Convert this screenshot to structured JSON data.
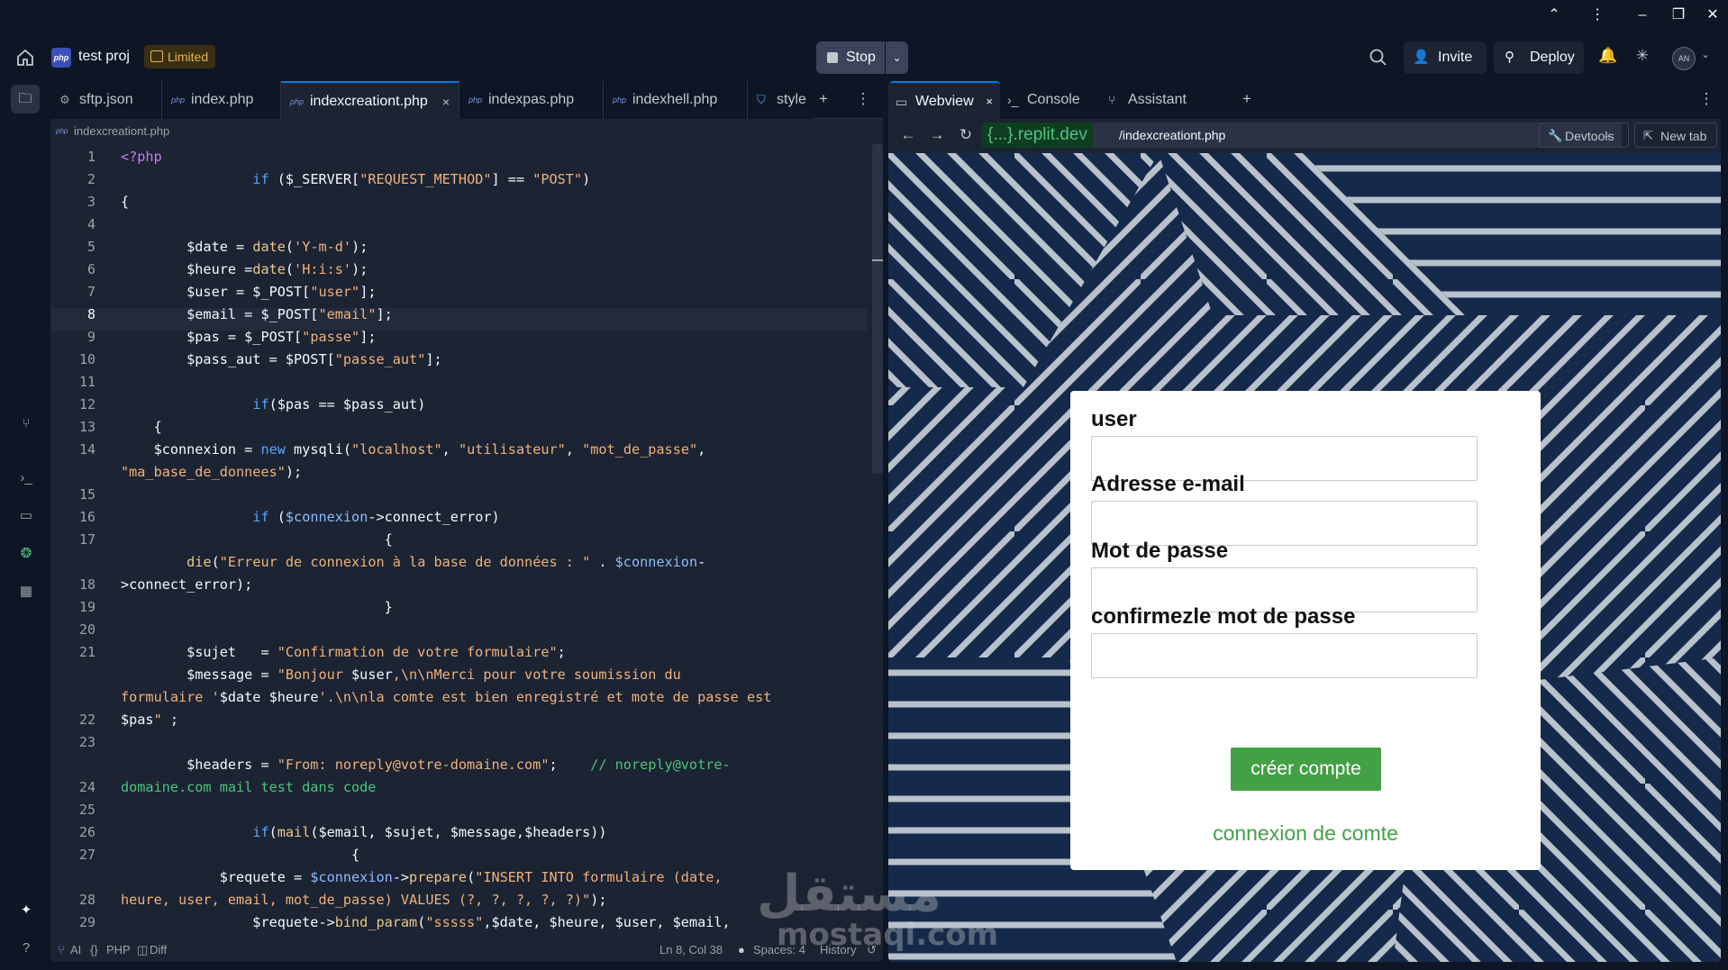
{
  "window": {
    "controls": [
      "⌃",
      "⋮",
      "–",
      "❐",
      "✕"
    ]
  },
  "header": {
    "project_name": "test proj",
    "limited_label": "Limited",
    "stop_label": "Stop",
    "invite_label": "Invite",
    "deploy_label": "Deploy",
    "avatar_initials": "AN"
  },
  "editor": {
    "tabs": [
      {
        "label": "sftp.json",
        "icon": "settings-icon"
      },
      {
        "label": "index.php",
        "icon": "php-icon"
      },
      {
        "label": "indexcreationt.php",
        "icon": "php-icon",
        "active": true
      },
      {
        "label": "indexpas.php",
        "icon": "php-icon"
      },
      {
        "label": "indexhell.php",
        "icon": "php-icon"
      },
      {
        "label": "style",
        "icon": "css-icon"
      }
    ],
    "breadcrumb": "indexcreationt.php",
    "line_numbers": [
      "1",
      "2",
      "3",
      "4",
      "5",
      "6",
      "7",
      "8",
      "9",
      "10",
      "11",
      "12",
      "13",
      "14",
      "15",
      "16",
      "17",
      "18",
      "19",
      "20",
      "21",
      "22",
      "23",
      "24",
      "25",
      "26",
      "27",
      "28",
      "29"
    ],
    "current_line": 8,
    "status": {
      "ai": "AI",
      "language": "PHP",
      "diff": "Diff",
      "position": "Ln 8, Col 38",
      "spaces": "Spaces: 4",
      "history": "History"
    }
  },
  "preview": {
    "tabs": [
      {
        "label": "Webview",
        "active": true
      },
      {
        "label": "Console"
      },
      {
        "label": "Assistant"
      }
    ],
    "url_domain": "{...}.replit.dev",
    "url_path": "/indexcreationt.php",
    "devtools_label": "Devtools",
    "newtab_label": "New tab",
    "form": {
      "user_label": "user",
      "email_label": "Adresse e-mail",
      "password_label": "Mot de passe",
      "confirm_label": "confirmezle mot de passe",
      "submit_label": "créer compte",
      "login_link": "connexion de comte"
    }
  },
  "watermark": {
    "arabic": "مستقل",
    "latin": "mostaql.com"
  }
}
